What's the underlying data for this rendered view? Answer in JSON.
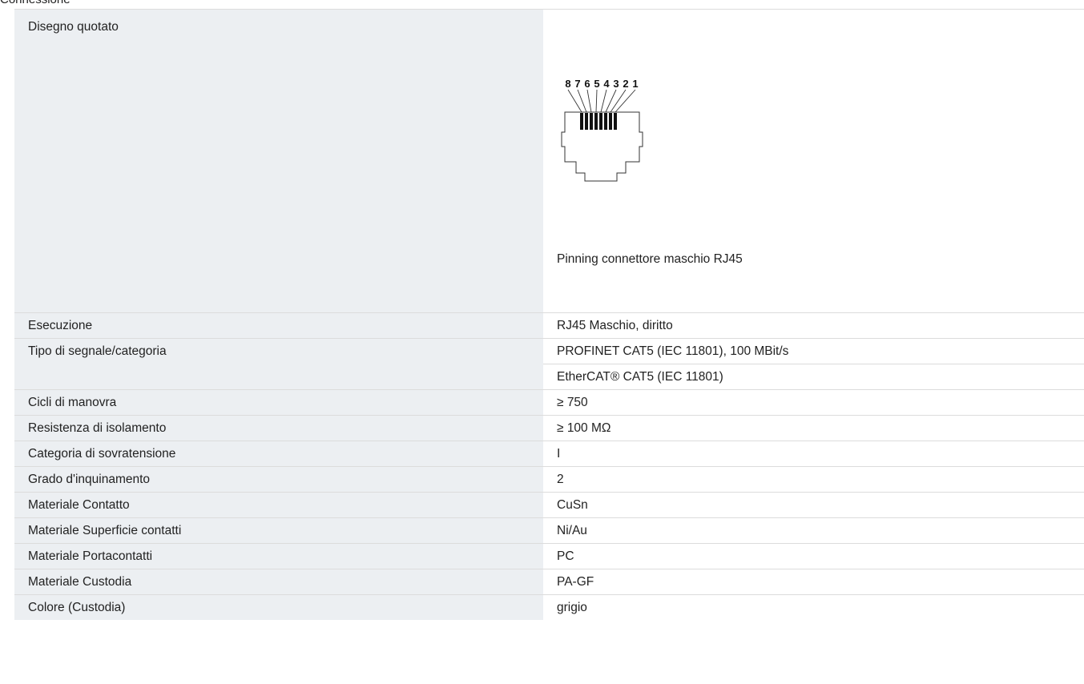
{
  "section_title": "Connessione",
  "drawing": {
    "label": "Disegno quotato",
    "pin_numbers": [
      "8",
      "7",
      "6",
      "5",
      "4",
      "3",
      "2",
      "1"
    ],
    "caption": "Pinning connettore maschio RJ45"
  },
  "rows": [
    {
      "label": "Esecuzione",
      "value": "RJ45 Maschio, diritto"
    },
    {
      "label": "Tipo di segnale/categoria",
      "value": "PROFINET CAT5 (IEC 11801), 100 MBit/s"
    },
    {
      "label": "",
      "value": "EtherCAT® CAT5 (IEC 11801)"
    },
    {
      "label": "Cicli di manovra",
      "value": "≥ 750"
    },
    {
      "label": "Resistenza di isolamento",
      "value": "≥ 100 MΩ"
    },
    {
      "label": "Categoria di sovratensione",
      "value": "I"
    },
    {
      "label": "Grado d'inquinamento",
      "value": "2"
    },
    {
      "label": "Materiale Contatto",
      "value": "CuSn"
    },
    {
      "label": "Materiale Superficie contatti",
      "value": "Ni/Au"
    },
    {
      "label": "Materiale Portacontatti",
      "value": "PC"
    },
    {
      "label": "Materiale Custodia",
      "value": "PA-GF"
    },
    {
      "label": "Colore (Custodia)",
      "value": "grigio"
    }
  ]
}
